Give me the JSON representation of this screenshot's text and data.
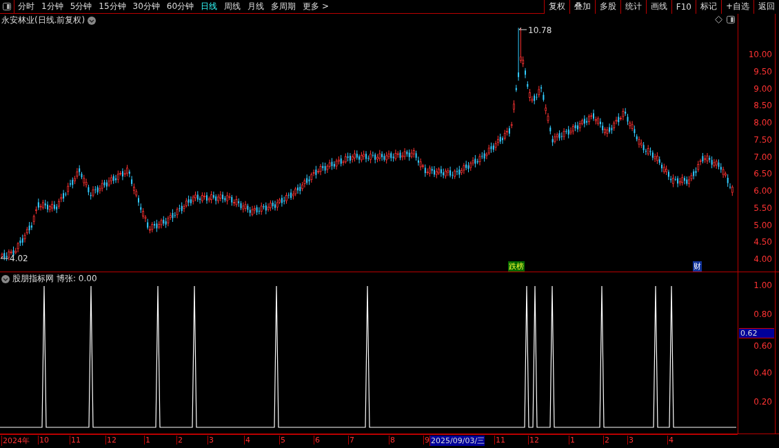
{
  "toolbar": {
    "periods": [
      {
        "label": "分时",
        "selected": false
      },
      {
        "label": "1分钟",
        "selected": false
      },
      {
        "label": "5分钟",
        "selected": false
      },
      {
        "label": "15分钟",
        "selected": false
      },
      {
        "label": "30分钟",
        "selected": false
      },
      {
        "label": "60分钟",
        "selected": false
      },
      {
        "label": "日线",
        "selected": true
      },
      {
        "label": "周线",
        "selected": false
      },
      {
        "label": "月线",
        "selected": false
      },
      {
        "label": "多周期",
        "selected": false
      },
      {
        "label": "更多 >",
        "selected": false
      }
    ],
    "buttons": [
      "复权",
      "叠加",
      "多股",
      "统计",
      "画线",
      "F10",
      "标记",
      "+自选",
      "返回"
    ]
  },
  "main_chart": {
    "title": "永安林业(日线.前复权)",
    "high_label": "10.78",
    "low_label": "4.02",
    "price_ticks": [
      "10.00",
      "9.50",
      "9.00",
      "8.50",
      "8.00",
      "7.50",
      "7.00",
      "6.50",
      "6.00",
      "5.50",
      "5.00",
      "4.50",
      "4.00"
    ],
    "event_tags": [
      {
        "label": "跌榜",
        "kind": "ranking"
      },
      {
        "label": "财",
        "kind": "finance"
      }
    ]
  },
  "indicator": {
    "name": "股朋指标网",
    "reading": "博张: 0.00",
    "ticks": [
      "1.00",
      "0.80",
      "0.60",
      "0.40",
      "0.20"
    ],
    "cursor_value": "0.62"
  },
  "time_axis": {
    "labels": [
      {
        "label": "2024年",
        "selected": false
      },
      {
        "label": "10",
        "selected": false
      },
      {
        "label": "11",
        "selected": false
      },
      {
        "label": "12",
        "selected": false
      },
      {
        "label": "1",
        "selected": false
      },
      {
        "label": "2",
        "selected": false
      },
      {
        "label": "3",
        "selected": false
      },
      {
        "label": "4",
        "selected": false
      },
      {
        "label": "5",
        "selected": false
      },
      {
        "label": "6",
        "selected": false
      },
      {
        "label": "7",
        "selected": false
      },
      {
        "label": "8",
        "selected": false
      },
      {
        "label": "9",
        "selected": false
      },
      {
        "label": "2025/09/03/三",
        "selected": true
      },
      {
        "label": "11",
        "selected": false
      },
      {
        "label": "12",
        "selected": false
      },
      {
        "label": "1",
        "selected": false
      },
      {
        "label": "2",
        "selected": false
      },
      {
        "label": "3",
        "selected": false
      },
      {
        "label": "4",
        "selected": false
      }
    ]
  }
}
